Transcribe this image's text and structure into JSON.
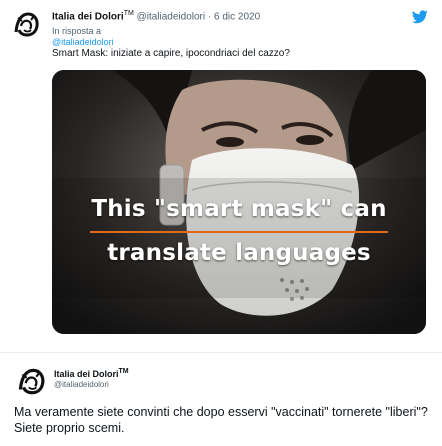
{
  "tweet": {
    "author_name": "Italia dei Dolori",
    "author_mark": "TM",
    "handle": "@italiadeidolori",
    "separator": "·",
    "date": "6 dic 2020",
    "reply_prefix": "In risposta a",
    "reply_handle": "@italiadeidolori",
    "text": "Smart Mask: iniziate a capire, ipocondriaci del cazzo?",
    "media": {
      "line1": "This \"smart mask\" can",
      "line2": "translate languages"
    }
  },
  "quoted_reply": {
    "author_name": "Italia dei Dolori",
    "author_mark": "TM",
    "handle": "@italiadeidolori",
    "text": "Ma veramente siete convinti che dopo esservi \"vaccinati\" tornerete \"liberi\"? Siete proprio scemi."
  },
  "colors": {
    "link": "#1d9bf0",
    "muted": "#536471",
    "accent_underline": "#e2681c"
  }
}
